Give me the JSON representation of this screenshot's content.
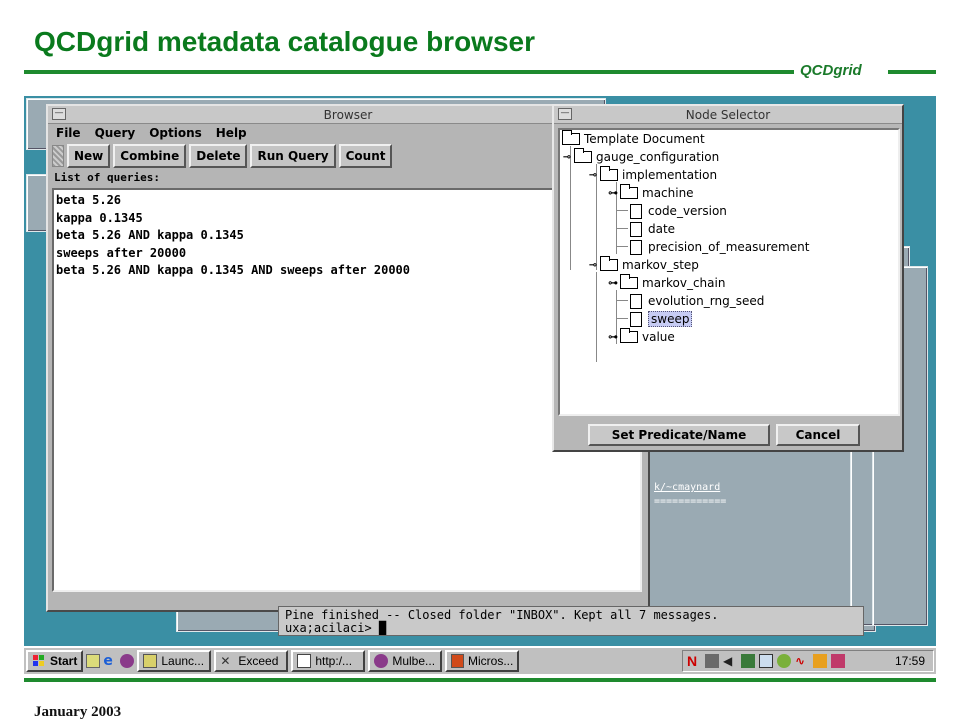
{
  "slide": {
    "title": "QCDgrid metadata catalogue browser",
    "brand": "QCDgrid",
    "footer": "January 2003",
    "accent_color": "#0a7a1d"
  },
  "browser": {
    "title": "Browser",
    "menu": [
      "File",
      "Query",
      "Options",
      "Help"
    ],
    "toolbar": [
      "New",
      "Combine",
      "Delete",
      "Run Query",
      "Count"
    ],
    "list_label": "List of queries:",
    "queries": [
      "beta 5.26",
      "kappa 0.1345",
      "beta 5.26 AND kappa 0.1345",
      "sweeps after 20000",
      "beta 5.26 AND kappa 0.1345 AND sweeps after 20000"
    ]
  },
  "node_selector": {
    "title": "Node Selector",
    "tree": [
      {
        "label": "Template Document",
        "icon": "folder-icon"
      },
      {
        "label": "gauge_configuration",
        "icon": "folder-icon"
      },
      {
        "label": "implementation",
        "icon": "folder-icon"
      },
      {
        "label": "machine",
        "icon": "folder-icon"
      },
      {
        "label": "code_version",
        "icon": "file-icon"
      },
      {
        "label": "date",
        "icon": "file-icon"
      },
      {
        "label": "precision_of_measurement",
        "icon": "file-icon"
      },
      {
        "label": "markov_step",
        "icon": "folder-icon"
      },
      {
        "label": "markov_chain",
        "icon": "folder-icon"
      },
      {
        "label": "evolution_rng_seed",
        "icon": "file-icon"
      },
      {
        "label": "sweep",
        "icon": "file-icon",
        "selected": true
      },
      {
        "label": "value",
        "icon": "folder-icon"
      }
    ],
    "buttons": [
      "Set Predicate/Name",
      "Cancel"
    ]
  },
  "terminal": {
    "line1": "Pine finished -- Closed folder \"INBOX\". Kept all 7 messages.",
    "line2": "uxa;acilaci> ",
    "fragments": [
      "k/~cmaynard",
      "============"
    ]
  },
  "taskbar": {
    "start": "Start",
    "buttons": [
      "Launc...",
      "Exceed",
      "http:/...",
      "Mulbe...",
      "Micros..."
    ],
    "clock": "17:59"
  }
}
